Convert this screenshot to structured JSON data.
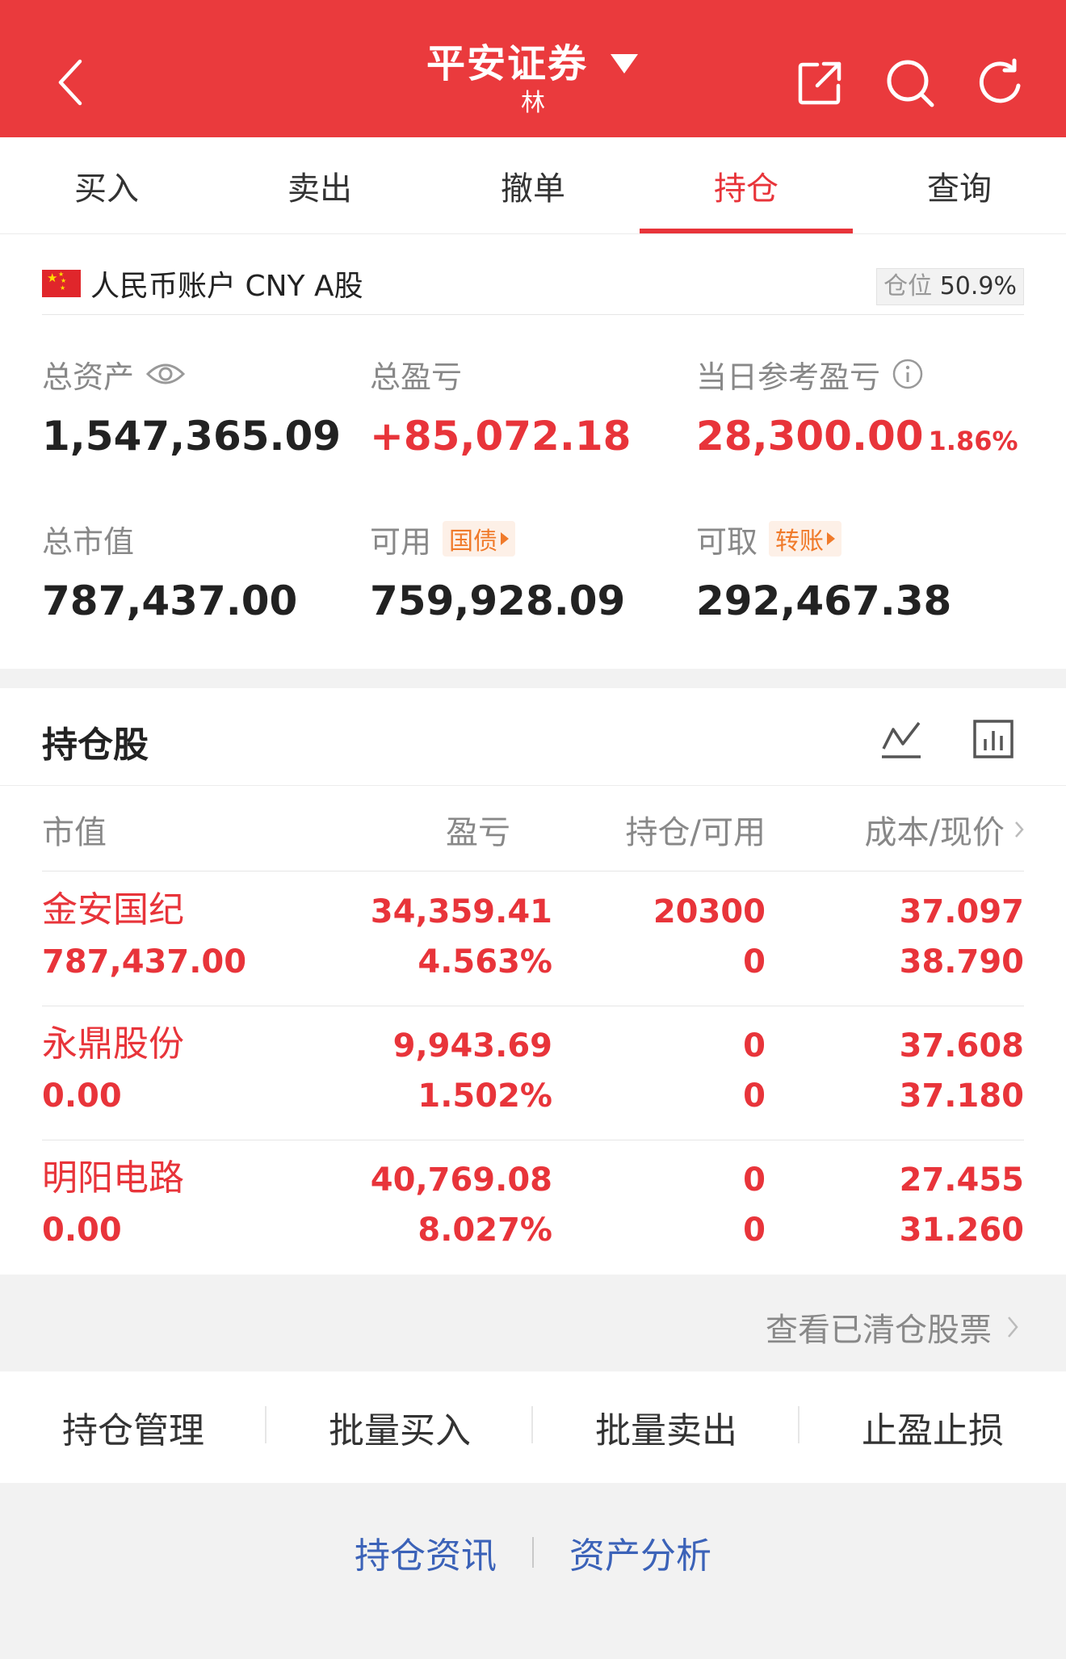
{
  "header": {
    "title": "平安证券",
    "subtitle": "林",
    "bg_color": "#ea3a3d",
    "icons": [
      "back-arrow-icon",
      "dropdown-triangle-icon",
      "share-icon",
      "search-icon",
      "refresh-icon"
    ]
  },
  "tabs": [
    {
      "label": "买入",
      "active": false
    },
    {
      "label": "卖出",
      "active": false
    },
    {
      "label": "撤单",
      "active": false
    },
    {
      "label": "持仓",
      "active": true
    },
    {
      "label": "查询",
      "active": false
    }
  ],
  "account": {
    "name": "人民币账户 CNY A股",
    "position_label": "仓位",
    "position_value": "50.9%"
  },
  "summary": {
    "total_assets": {
      "label": "总资产",
      "value": "1,547,365.09"
    },
    "total_pnl": {
      "label": "总盈亏",
      "value": "+85,072.18"
    },
    "daily_pnl": {
      "label": "当日参考盈亏",
      "value": "28,300.00",
      "pct": "1.86%"
    },
    "market_value": {
      "label": "总市值",
      "value": "787,437.00"
    },
    "available": {
      "label": "可用",
      "tag": "国债",
      "value": "759,928.09"
    },
    "withdrawable": {
      "label": "可取",
      "tag": "转账",
      "value": "292,467.38"
    }
  },
  "holdings": {
    "title": "持仓股",
    "columns": [
      "市值",
      "盈亏",
      "持仓/可用",
      "成本/现价"
    ],
    "rows": [
      {
        "name": "金安国纪",
        "market_value": "787,437.00",
        "pnl": "34,359.41",
        "pnl_pct": "4.563%",
        "position": "20300",
        "available": "0",
        "cost": "37.097",
        "price": "38.790"
      },
      {
        "name": "永鼎股份",
        "market_value": "0.00",
        "pnl": "9,943.69",
        "pnl_pct": "1.502%",
        "position": "0",
        "available": "0",
        "cost": "37.608",
        "price": "37.180"
      },
      {
        "name": "明阳电路",
        "market_value": "0.00",
        "pnl": "40,769.08",
        "pnl_pct": "8.027%",
        "position": "0",
        "available": "0",
        "cost": "27.455",
        "price": "31.260"
      }
    ],
    "cleared_link": "查看已清仓股票"
  },
  "actions": [
    "持仓管理",
    "批量买入",
    "批量卖出",
    "止盈止损"
  ],
  "bottom_links": [
    "持仓资讯",
    "资产分析"
  ],
  "colors": {
    "accent": "#e8343a",
    "link_blue": "#3b62b8",
    "tag_orange": "#f07a2a"
  }
}
